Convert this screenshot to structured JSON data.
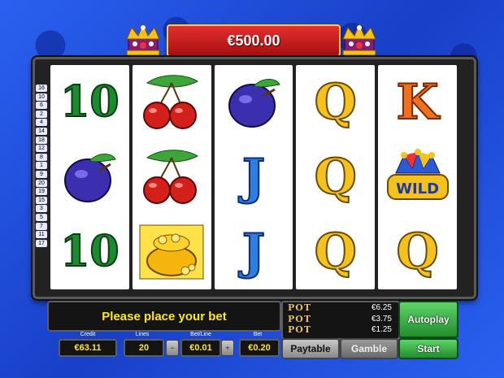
{
  "jackpot": "€500.00",
  "lines_indicator": [
    "16",
    "10",
    "6",
    "2",
    "4",
    "14",
    "18",
    "12",
    "8",
    "1",
    "9",
    "20",
    "19",
    "15",
    "3",
    "5",
    "7",
    "11",
    "17"
  ],
  "reels": [
    [
      "10",
      "plum",
      "10"
    ],
    [
      "cherry",
      "cherry",
      "gold-pot"
    ],
    [
      "plum",
      "J",
      "J"
    ],
    [
      "Q",
      "Q",
      "Q"
    ],
    [
      "K",
      "wild",
      "Q"
    ]
  ],
  "wild_label": "WILD",
  "message": "Please place your bet",
  "pots": [
    {
      "label": "POT",
      "value": "€6.25"
    },
    {
      "label": "POT",
      "value": "€3.75"
    },
    {
      "label": "POT",
      "value": "€1.25"
    }
  ],
  "buttons": {
    "autoplay": "Autoplay",
    "start": "Start",
    "paytable": "Paytable",
    "gamble": "Gamble"
  },
  "fields": {
    "credit_label": "Credit",
    "credit_value": "€63.11",
    "lines_label": "Lines",
    "lines_value": "20",
    "betline_label": "Bet/Line",
    "betline_value": "€0.01",
    "bet_label": "Bet",
    "bet_value": "€0.20"
  }
}
